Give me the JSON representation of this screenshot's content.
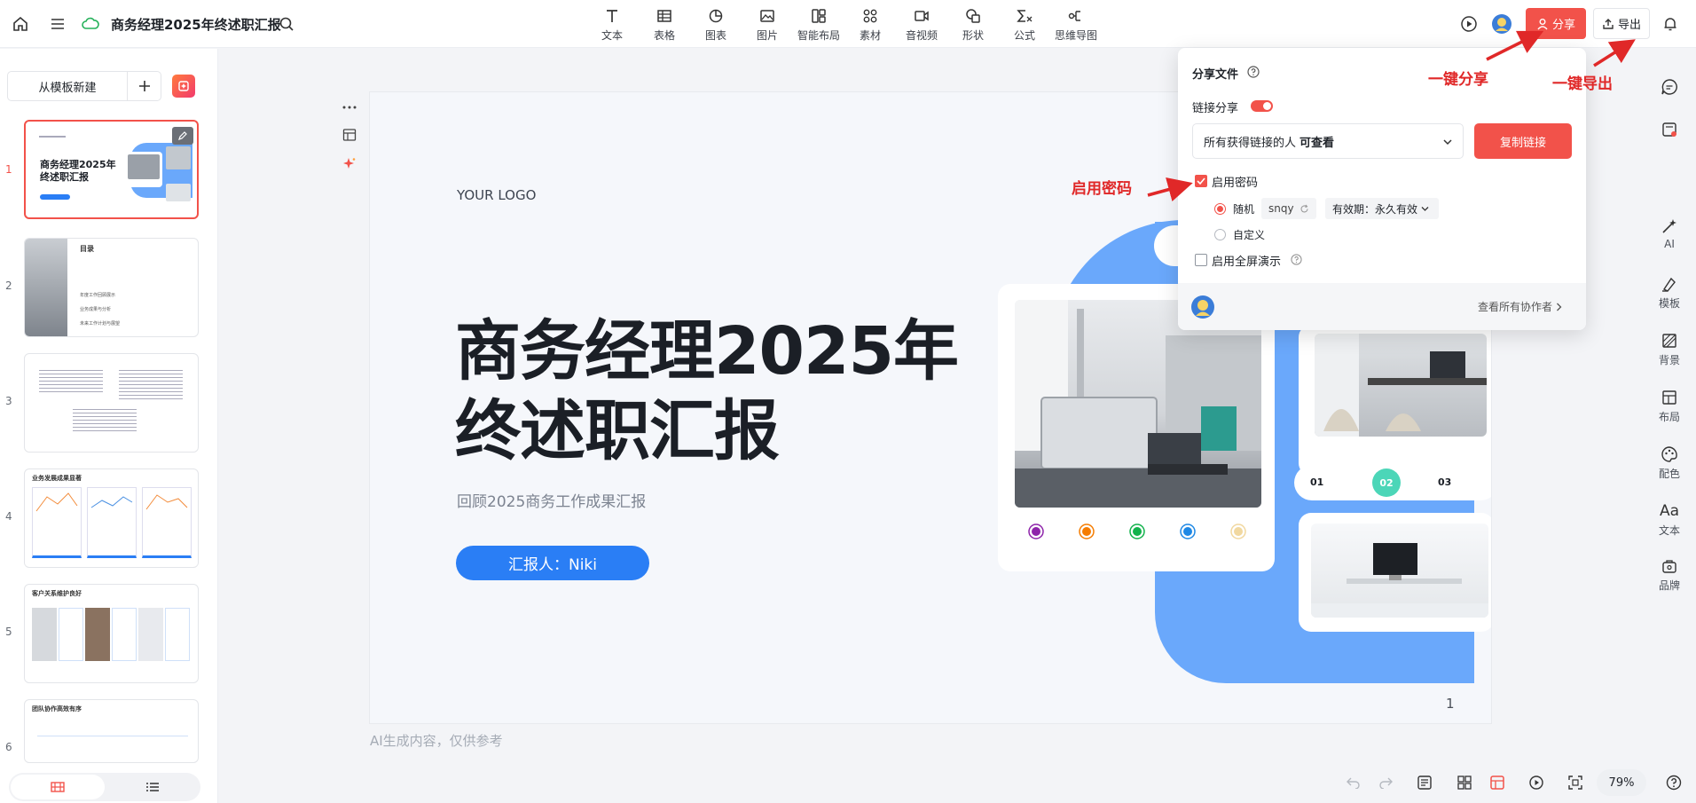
{
  "header": {
    "title": "商务经理2025年终述职汇报",
    "tools": [
      {
        "label": "文本",
        "icon": "text-icon"
      },
      {
        "label": "表格",
        "icon": "table-icon"
      },
      {
        "label": "图表",
        "icon": "chart-icon"
      },
      {
        "label": "图片",
        "icon": "image-icon"
      },
      {
        "label": "智能布局",
        "icon": "smart-layout-icon"
      },
      {
        "label": "素材",
        "icon": "assets-icon"
      },
      {
        "label": "音视频",
        "icon": "media-icon"
      },
      {
        "label": "形状",
        "icon": "shape-icon"
      },
      {
        "label": "公式",
        "icon": "formula-icon"
      },
      {
        "label": "思维导图",
        "icon": "mindmap-icon"
      }
    ],
    "share_label": "分享",
    "export_label": "导出"
  },
  "left_panel": {
    "from_template_label": "从模板新建",
    "slide_numbers": [
      "1",
      "2",
      "3",
      "4",
      "5",
      "6"
    ],
    "thumb2_title": "目录",
    "thumb2_items": [
      "年度工作回顾展示",
      "业务成果与分析",
      "未来工作计划与展望"
    ],
    "thumb4_title": "业务发展成果显著",
    "thumb5_title": "客户关系维护良好",
    "thumb6_title": "团队协作高效有序"
  },
  "slide": {
    "logo": "YOUR LOGO",
    "title": "商务经理2025年\n终述职汇报",
    "subtitle": "回顾2025商务工作成果汇报",
    "reporter": "汇报人：Niki",
    "steps": [
      "01",
      "02",
      "03"
    ],
    "page_number": "1",
    "dot_colors": [
      "#8e24aa",
      "#f57c00",
      "#12b24c",
      "#1e88e5",
      "#f1d8a0"
    ],
    "accent": "#6aa8fb"
  },
  "ai_note": "AI生成内容，仅供参考",
  "share_popover": {
    "title": "分享文件",
    "link_share_label": "链接分享",
    "permission_prefix": "所有获得链接的人",
    "permission_value": "可查看",
    "copy_link_label": "复制链接",
    "enable_password_label": "启用密码",
    "random_label": "随机",
    "password_value": "snqy",
    "validity_label": "有效期：永久有效",
    "custom_label": "自定义",
    "fullscreen_label": "启用全屏演示",
    "view_collaborators_label": "查看所有协作者"
  },
  "annotations": {
    "share": "一键分享",
    "export": "一键导出",
    "password": "启用密码"
  },
  "right_rail": [
    {
      "label": "AI",
      "icon": "ai-wand-icon"
    },
    {
      "label": "模板",
      "icon": "template-icon"
    },
    {
      "label": "背景",
      "icon": "background-icon"
    },
    {
      "label": "布局",
      "icon": "layout-icon"
    },
    {
      "label": "配色",
      "icon": "palette-icon"
    },
    {
      "label": "文本",
      "icon": "text-aa-icon"
    },
    {
      "label": "品牌",
      "icon": "brand-icon"
    }
  ],
  "bottom_bar": {
    "zoom": "79%"
  },
  "colors": {
    "brand_red": "#f2524a",
    "primary_blue": "#2a7ef5",
    "annotation_red": "#e02828"
  }
}
